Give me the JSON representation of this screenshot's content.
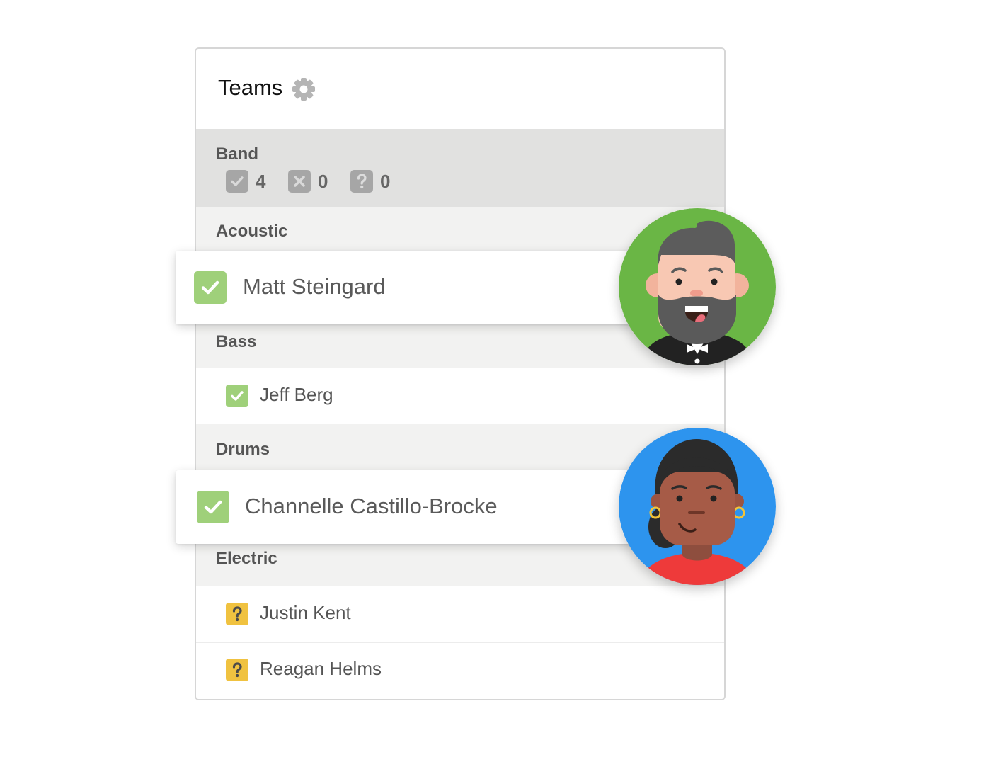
{
  "panel": {
    "title": "Teams",
    "settings_icon": "gear-icon"
  },
  "team": {
    "name": "Band",
    "stats": [
      {
        "icon": "check-icon",
        "count": "4"
      },
      {
        "icon": "x-icon",
        "count": "0"
      },
      {
        "icon": "question-icon",
        "count": "0"
      }
    ]
  },
  "groups": [
    {
      "label": "Acoustic",
      "members": [
        {
          "name": "Matt Steingard",
          "status": "confirmed",
          "status_icon": "check-icon",
          "avatar": "bearded-man-avatar",
          "avatar_bg": "#6ab645"
        }
      ]
    },
    {
      "label": "Bass",
      "members": [
        {
          "name": "Jeff Berg",
          "status": "confirmed",
          "status_icon": "check-icon"
        }
      ]
    },
    {
      "label": "Drums",
      "members": [
        {
          "name": "Channelle Castillo-Brocke",
          "status": "confirmed",
          "status_icon": "check-icon",
          "avatar": "woman-avatar",
          "avatar_bg": "#2d94ee"
        }
      ]
    },
    {
      "label": "Electric",
      "members": [
        {
          "name": "Justin Kent",
          "status": "unconfirmed",
          "status_icon": "question-icon"
        },
        {
          "name": "Reagan Helms",
          "status": "unconfirmed",
          "status_icon": "question-icon"
        }
      ]
    }
  ],
  "colors": {
    "confirmed": "#9fd07a",
    "unconfirmed": "#f0c240",
    "stat_box": "#a6a6a6",
    "team_row_bg": "#e1e1e0",
    "group_bg": "#f2f2f1"
  }
}
